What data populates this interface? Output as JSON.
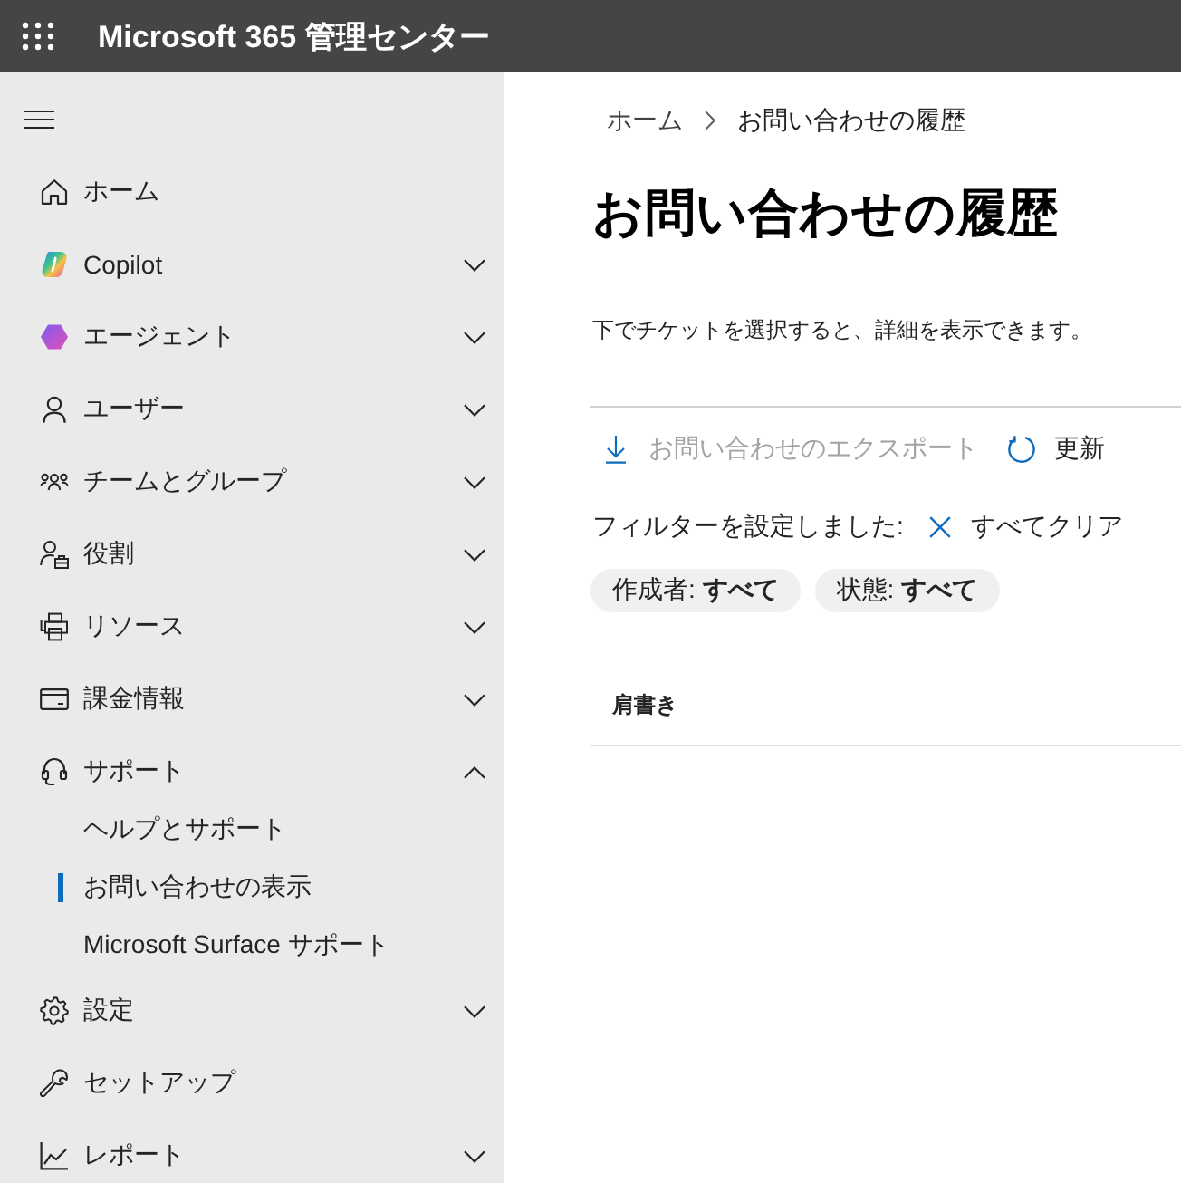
{
  "header": {
    "title": "Microsoft 365 管理センター"
  },
  "sidebar": {
    "items": [
      {
        "label": "ホーム",
        "selected": false
      },
      {
        "label": "Copilot",
        "selected": false,
        "expanded": false
      },
      {
        "label": "エージェント",
        "selected": false,
        "expanded": false
      },
      {
        "label": "ユーザー",
        "selected": false,
        "expanded": false
      },
      {
        "label": "チームとグループ",
        "selected": false,
        "expanded": false
      },
      {
        "label": "役割",
        "selected": false,
        "expanded": false
      },
      {
        "label": "リソース",
        "selected": false,
        "expanded": false
      },
      {
        "label": "課金情報",
        "selected": false,
        "expanded": false
      },
      {
        "label": "サポート",
        "selected": false,
        "expanded": true,
        "children": [
          {
            "label": "ヘルプとサポート",
            "selected": false
          },
          {
            "label": "お問い合わせの表示",
            "selected": true
          },
          {
            "label": "Microsoft Surface サポート",
            "selected": false
          }
        ]
      },
      {
        "label": "設定",
        "selected": false,
        "expanded": false
      },
      {
        "label": "セットアップ",
        "selected": false
      },
      {
        "label": "レポート",
        "selected": false,
        "expanded": false
      }
    ]
  },
  "breadcrumb": [
    "ホーム",
    "お問い合わせの履歴"
  ],
  "page": {
    "title": "お問い合わせの履歴",
    "description": "下でチケットを選択すると、詳細を表示できます。"
  },
  "toolbar": [
    {
      "label": "お問い合わせのエクスポート",
      "disabled": true
    },
    {
      "label": "更新",
      "disabled": false
    }
  ],
  "filters": {
    "label": "フィルターを設定しました:",
    "clear_button": "すべてクリア",
    "chips": [
      {
        "label": "作成者: **すべて**"
      },
      {
        "label": "状態: **すべて**"
      }
    ]
  },
  "table": {
    "columns": [
      "肩書き"
    ]
  }
}
